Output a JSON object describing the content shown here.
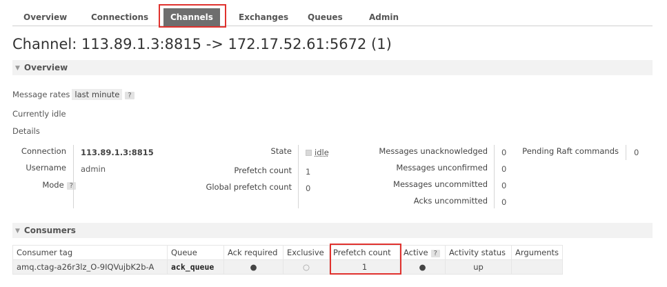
{
  "nav": {
    "tabs": [
      "Overview",
      "Connections",
      "Channels",
      "Exchanges",
      "Queues",
      "Admin"
    ],
    "active": "Channels"
  },
  "page_title": "Channel: 113.89.1.3:8815 -> 172.17.52.61:5672 (1)",
  "overview": {
    "section_label": "Overview",
    "message_rates_label": "Message rates",
    "message_rates_value": "last minute",
    "help": "?",
    "idle_text": "Currently idle",
    "details_label": "Details"
  },
  "details": {
    "connection_label": "Connection",
    "connection_value": "113.89.1.3:8815",
    "username_label": "Username",
    "username_value": "admin",
    "mode_label": "Mode",
    "mode_help": "?",
    "state_label": "State",
    "state_value": "idle",
    "prefetch_label": "Prefetch count",
    "prefetch_value": "1",
    "global_prefetch_label": "Global prefetch count",
    "global_prefetch_value": "0",
    "unacked_label": "Messages unacknowledged",
    "unacked_value": "0",
    "unconfirmed_label": "Messages unconfirmed",
    "unconfirmed_value": "0",
    "uncommitted_label": "Messages uncommitted",
    "uncommitted_value": "0",
    "acks_uncommitted_label": "Acks uncommitted",
    "acks_uncommitted_value": "0",
    "raft_label": "Pending Raft commands",
    "raft_value": "0"
  },
  "consumers": {
    "section_label": "Consumers",
    "headers": {
      "tag": "Consumer tag",
      "queue": "Queue",
      "ack": "Ack required",
      "exclusive": "Exclusive",
      "prefetch": "Prefetch count",
      "active": "Active",
      "active_help": "?",
      "status": "Activity status",
      "args": "Arguments"
    },
    "row": {
      "tag": "amq.ctag-a26r3lz_O-9IQVujbK2b-A",
      "queue": "ack_queue",
      "ack": "●",
      "exclusive": "○",
      "prefetch": "1",
      "active": "●",
      "status": "up",
      "args": ""
    }
  },
  "colors": {
    "highlight": "#e0312d",
    "active_tab": "#6e6e6e"
  }
}
